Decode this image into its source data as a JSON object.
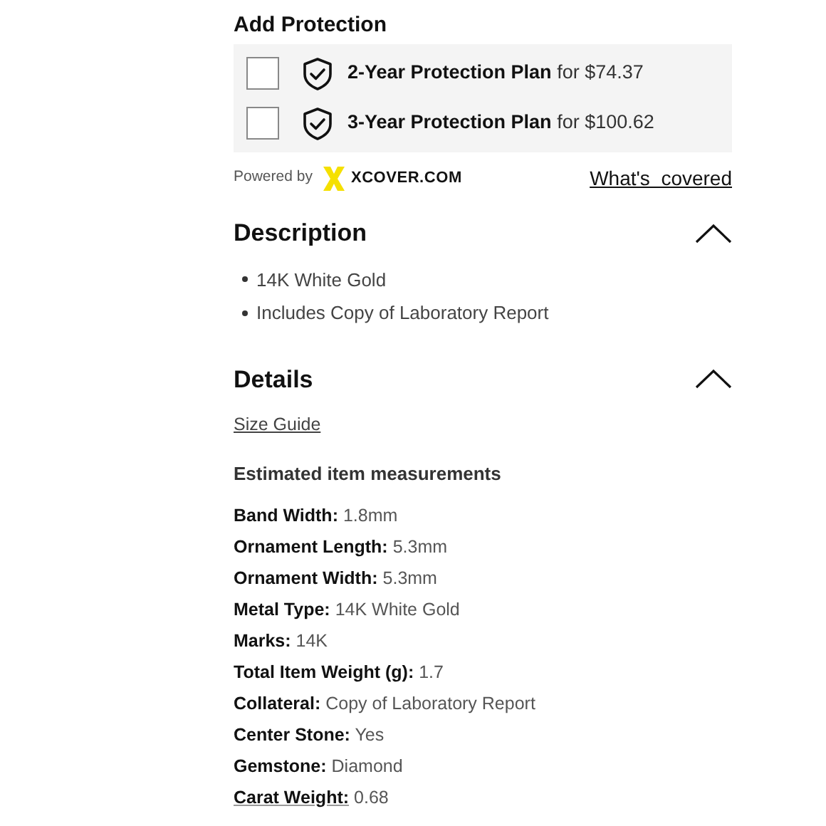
{
  "protection": {
    "title": "Add Protection",
    "plans": [
      {
        "name": "2-Year Protection Plan",
        "price": "for $74.37",
        "checked": false
      },
      {
        "name": "3-Year Protection Plan",
        "price": "for $100.62",
        "checked": false
      }
    ],
    "powered_by": "Powered by",
    "brand": "XCOVER.COM",
    "link": "What's  covered"
  },
  "description": {
    "title": "Description",
    "expanded": true,
    "items": [
      "14K White Gold",
      "Includes Copy of Laboratory Report"
    ]
  },
  "details": {
    "title": "Details",
    "expanded": true,
    "size_guide": "Size Guide",
    "subtitle": "Estimated item measurements",
    "rows": [
      {
        "label": "Band Width:",
        "value": "1.8mm",
        "underlined": false
      },
      {
        "label": "Ornament Length:",
        "value": "5.3mm",
        "underlined": false
      },
      {
        "label": "Ornament Width:",
        "value": "5.3mm",
        "underlined": false
      },
      {
        "label": "Metal Type:",
        "value": "14K White Gold",
        "underlined": false
      },
      {
        "label": "Marks:",
        "value": "14K",
        "underlined": false
      },
      {
        "label": "Total Item Weight (g):",
        "value": "1.7",
        "underlined": false
      },
      {
        "label": "Collateral:",
        "value": "Copy of Laboratory Report",
        "underlined": false
      },
      {
        "label": "Center Stone:",
        "value": "Yes",
        "underlined": false
      },
      {
        "label": "Gemstone:",
        "value": "Diamond",
        "underlined": false
      },
      {
        "label": "Carat Weight:",
        "value": "0.68",
        "underlined": true
      }
    ]
  }
}
